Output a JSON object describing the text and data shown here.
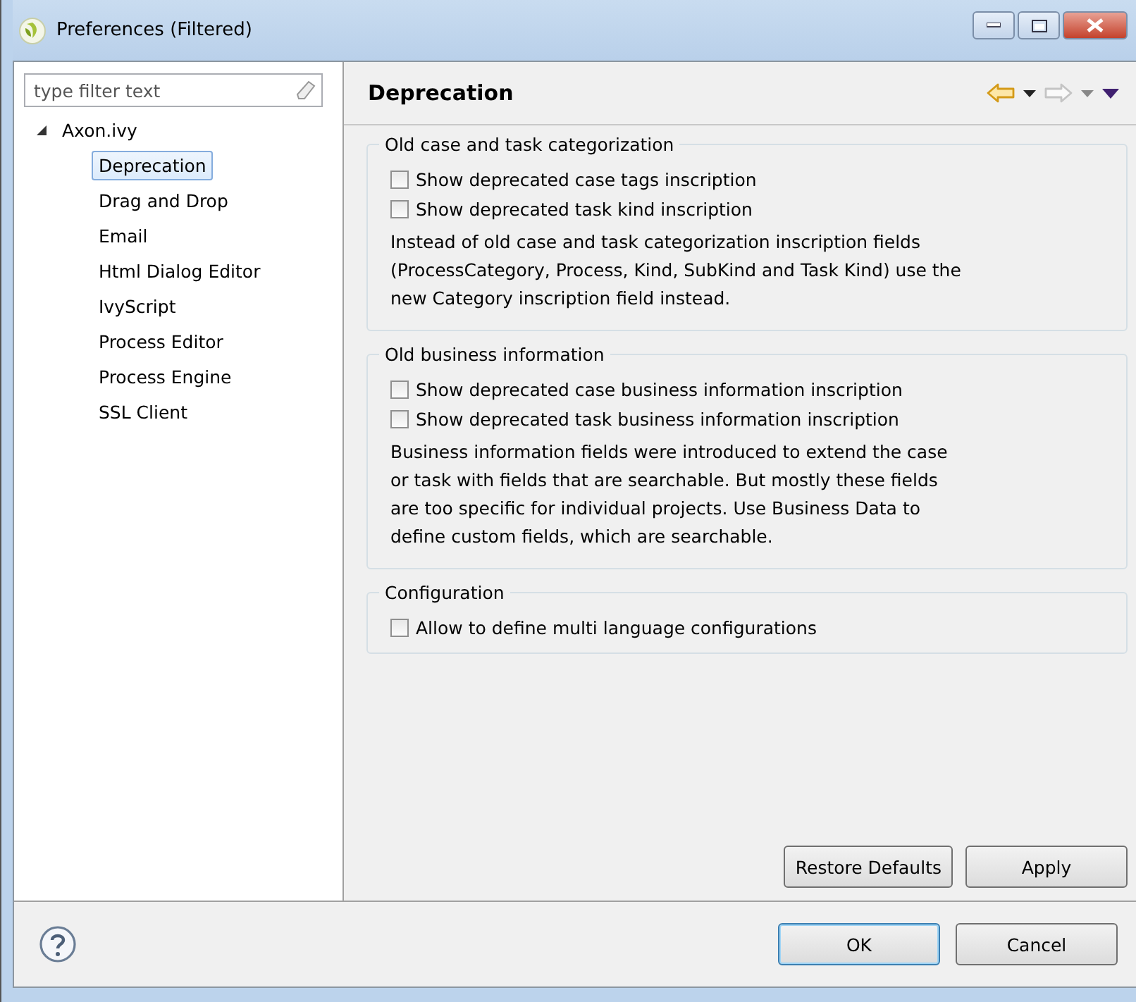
{
  "window": {
    "title": "Preferences (Filtered)"
  },
  "filter": {
    "placeholder": "type filter text"
  },
  "tree": [
    {
      "label": "Axon.ivy",
      "expanded": true,
      "selected": false,
      "children": [
        {
          "label": "Deprecation",
          "selected": true
        },
        {
          "label": "Drag and Drop",
          "selected": false
        },
        {
          "label": "Email",
          "selected": false
        },
        {
          "label": "Html Dialog Editor",
          "selected": false
        },
        {
          "label": "IvyScript",
          "selected": false
        },
        {
          "label": "Process Editor",
          "selected": false
        },
        {
          "label": "Process Engine",
          "selected": false
        },
        {
          "label": "SSL Client",
          "selected": false
        }
      ]
    }
  ],
  "page": {
    "title": "Deprecation",
    "groups": [
      {
        "title": "Old case and task categorization",
        "options": [
          {
            "label": "Show deprecated case tags inscription",
            "checked": false
          },
          {
            "label": "Show deprecated task kind inscription",
            "checked": false
          }
        ],
        "note": "Instead of old case and task categorization inscription fields (ProcessCategory, Process, Kind, SubKind and Task Kind) use the new Category inscription field instead."
      },
      {
        "title": "Old business information",
        "options": [
          {
            "label": "Show deprecated case business information inscription",
            "checked": false
          },
          {
            "label": "Show deprecated task business information inscription",
            "checked": false
          }
        ],
        "note": "Business information fields were introduced to extend the case or task with fields that are searchable. But mostly these fields are too specific for individual projects. Use Business Data to define custom fields, which are searchable."
      },
      {
        "title": "Configuration",
        "options": [
          {
            "label": "Allow to define multi language configurations",
            "checked": false
          }
        ]
      }
    ],
    "buttons": [
      "Restore Defaults",
      "Apply"
    ]
  },
  "dialog_buttons": [
    {
      "label": "OK",
      "default": true
    },
    {
      "label": "Cancel",
      "default": false
    }
  ]
}
